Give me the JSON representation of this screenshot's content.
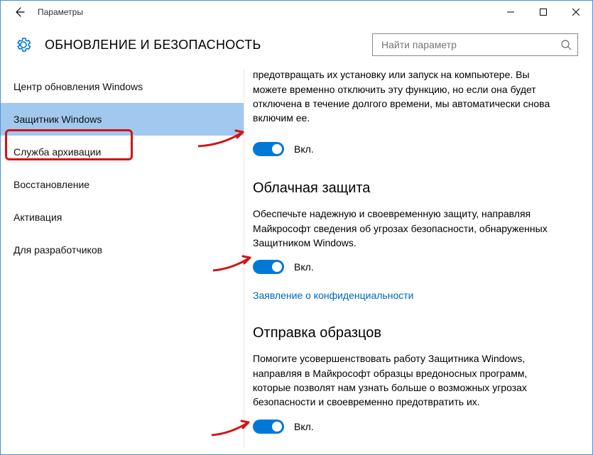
{
  "window": {
    "title": "Параметры"
  },
  "header": {
    "page_title": "ОБНОВЛЕНИЕ И БЕЗОПАСНОСТЬ"
  },
  "search": {
    "placeholder": "Найти параметр"
  },
  "sidebar": {
    "items": [
      {
        "label": "Центр обновления Windows"
      },
      {
        "label": "Защитник Windows"
      },
      {
        "label": "Служба архивации"
      },
      {
        "label": "Восстановление"
      },
      {
        "label": "Активация"
      },
      {
        "label": "Для разработчиков"
      }
    ],
    "selected_index": 1
  },
  "sections": {
    "realtime": {
      "desc_partial": "Это помогает обнаруживать вредоносные программы и предотвращать их установку или запуск на компьютере. Вы можете временно отключить эту функцию, но если она будет отключена в течение долгого времени, мы автоматически снова включим ее.",
      "toggle_state": "Вкл."
    },
    "cloud": {
      "heading": "Облачная защита",
      "desc": "Обеспечьте надежную и своевременную защиту, направляя Майкрософт сведения об угрозах безопасности, обнаруженных Защитником Windows.",
      "toggle_state": "Вкл.",
      "link": "Заявление о конфиденциальности"
    },
    "samples": {
      "heading": "Отправка образцов",
      "desc": "Помогите усовершенствовать работу Защитника Windows, направляя в Майкрософт образцы вредоносных программ, которые позволят нам узнать больше о возможных угрозах безопасности и своевременно предотвратить их.",
      "toggle_state": "Вкл."
    }
  }
}
